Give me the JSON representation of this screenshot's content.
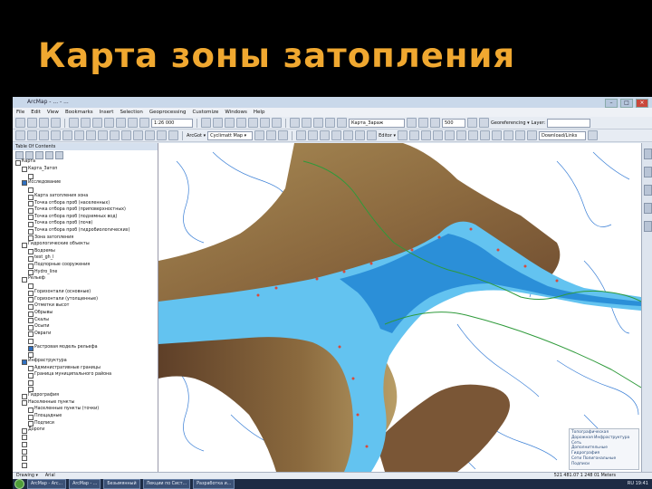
{
  "slide": {
    "title": "Карта зоны затопления"
  },
  "window": {
    "title": "ArcMap - ... - ...",
    "controls": [
      "–",
      "□",
      "×"
    ]
  },
  "menu": [
    "File",
    "Edit",
    "View",
    "Bookmarks",
    "Insert",
    "Selection",
    "Geoprocessing",
    "Customize",
    "Windows",
    "Help"
  ],
  "toolbar1": {
    "scale_value": "1:26 000",
    "layer_value": "Карта_Зараж",
    "value_500": "500",
    "georef_label": "Georeferencing ▾",
    "layer_label": "Layer:"
  },
  "toolbar2": {
    "arcgot_label": "ArcGot ▾",
    "symbol_label": "Cyclimatt Map ▾",
    "editor_label": "Editor ▾",
    "download_label": "Download/Links"
  },
  "toc": {
    "header": "Table Of Contents",
    "layers": [
      {
        "indent": 0,
        "checked": false,
        "label": "Карта"
      },
      {
        "indent": 1,
        "checked": false,
        "label": "Карта_Затоп"
      },
      {
        "indent": 2,
        "checked": false,
        "label": ""
      },
      {
        "indent": 1,
        "checked": true,
        "label": "Исследование"
      },
      {
        "indent": 2,
        "checked": false,
        "label": ""
      },
      {
        "indent": 2,
        "checked": false,
        "label": "Карта затопления зона"
      },
      {
        "indent": 2,
        "checked": false,
        "label": "Точка отбора проб (населенных)"
      },
      {
        "indent": 2,
        "checked": false,
        "label": "Точка отбора проб (приповерхностных)"
      },
      {
        "indent": 2,
        "checked": false,
        "label": "Точка отбора проб (подземных вод)"
      },
      {
        "indent": 2,
        "checked": false,
        "label": "Точка отбора проб (почв)"
      },
      {
        "indent": 2,
        "checked": false,
        "label": "Точка отбора проб (гидробиологических)"
      },
      {
        "indent": 2,
        "checked": false,
        "label": "Зона затопления"
      },
      {
        "indent": 1,
        "checked": false,
        "label": "Гидрологические объекты"
      },
      {
        "indent": 2,
        "checked": false,
        "label": "Водоемы"
      },
      {
        "indent": 2,
        "checked": false,
        "label": "test_gh_l"
      },
      {
        "indent": 2,
        "checked": false,
        "label": "Подпорные сооружения"
      },
      {
        "indent": 2,
        "checked": false,
        "label": "Hydro_line"
      },
      {
        "indent": 1,
        "checked": false,
        "label": "Рельеф"
      },
      {
        "indent": 2,
        "checked": false,
        "label": ""
      },
      {
        "indent": 2,
        "checked": false,
        "label": "Горизонтали (основные)"
      },
      {
        "indent": 2,
        "checked": false,
        "label": "Горизонтали (утолщенные)"
      },
      {
        "indent": 2,
        "checked": false,
        "label": "Отметки высот"
      },
      {
        "indent": 2,
        "checked": false,
        "label": "Обрывы"
      },
      {
        "indent": 2,
        "checked": false,
        "label": "Скалы"
      },
      {
        "indent": 2,
        "checked": false,
        "label": "Осыпи"
      },
      {
        "indent": 2,
        "checked": false,
        "label": "Овраги"
      },
      {
        "indent": 2,
        "checked": false,
        "label": ""
      },
      {
        "indent": 2,
        "checked": true,
        "label": "Растровая модель рельефа"
      },
      {
        "indent": 2,
        "checked": false,
        "label": ""
      },
      {
        "indent": 1,
        "checked": true,
        "label": "Инфраструктура"
      },
      {
        "indent": 2,
        "checked": false,
        "label": "Административные границы"
      },
      {
        "indent": 2,
        "checked": false,
        "label": "Граница муниципального района"
      },
      {
        "indent": 2,
        "checked": false,
        "label": ""
      },
      {
        "indent": 2,
        "checked": false,
        "label": ""
      },
      {
        "indent": 1,
        "checked": false,
        "label": "Гидрография"
      },
      {
        "indent": 1,
        "checked": false,
        "label": "Населенные пункты"
      },
      {
        "indent": 2,
        "checked": false,
        "label": "Населенные пункты (точки)"
      },
      {
        "indent": 2,
        "checked": false,
        "label": "Площадные"
      },
      {
        "indent": 2,
        "checked": false,
        "label": "Подписи"
      },
      {
        "indent": 1,
        "checked": false,
        "label": "Дороги"
      },
      {
        "indent": 1,
        "checked": false,
        "label": ""
      },
      {
        "indent": 1,
        "checked": false,
        "label": ""
      },
      {
        "indent": 1,
        "checked": false,
        "label": ""
      },
      {
        "indent": 1,
        "checked": false,
        "label": ""
      },
      {
        "indent": 1,
        "checked": false,
        "label": ""
      }
    ]
  },
  "status": {
    "drawing_label": "Drawing ▾",
    "font_label": "Arial",
    "coords": "521 481.07  1 248 01 Meters"
  },
  "side_panel": {
    "lines": [
      "Топографическая",
      "Дорожная Инфраструктура",
      "Сеть",
      "Дополнительные",
      "Гидрография",
      "Сети Полигональные",
      "Подписи"
    ]
  },
  "taskbar": {
    "items": [
      "ArcMap - Arc...",
      "ArcMap - ...",
      "Безымянный",
      "Лекции по Сист...",
      "Разработка и..."
    ],
    "tray": "RU  19:41"
  },
  "colors": {
    "flood": "#63c3f0",
    "flood_deep": "#2b8fd8",
    "relief_dark": "#6e4b2f",
    "relief_mid": "#a88b55",
    "river": "#3a7fd6",
    "boundary": "#2e9a3a"
  }
}
